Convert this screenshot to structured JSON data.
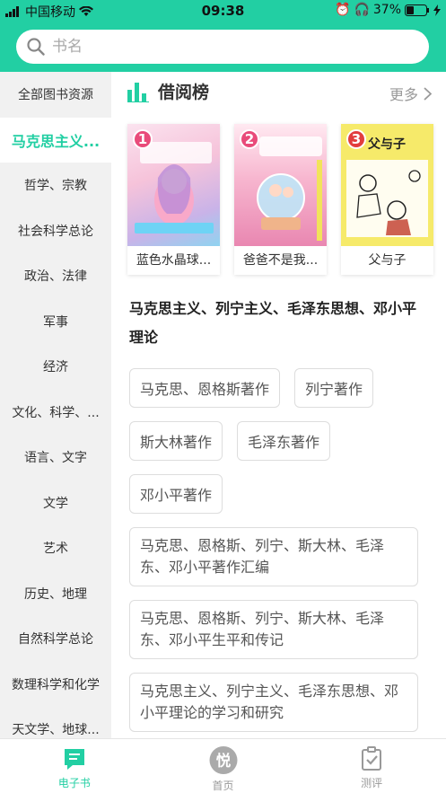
{
  "status_bar": {
    "carrier": "中国移动",
    "time": "09:38",
    "battery": "37%"
  },
  "search": {
    "placeholder": "书名"
  },
  "sidebar": {
    "items": [
      {
        "label": "全部图书资源"
      },
      {
        "label": "马克思主义..."
      },
      {
        "label": "哲学、宗教"
      },
      {
        "label": "社会科学总论"
      },
      {
        "label": "政治、法律"
      },
      {
        "label": "军事"
      },
      {
        "label": "经济"
      },
      {
        "label": "文化、科学、..."
      },
      {
        "label": "语言、文字"
      },
      {
        "label": "文学"
      },
      {
        "label": "艺术"
      },
      {
        "label": "历史、地理"
      },
      {
        "label": "自然科学总论"
      },
      {
        "label": "数理科学和化学"
      },
      {
        "label": "天文学、地球..."
      }
    ],
    "active_index": 1
  },
  "ranking": {
    "title": "借阅榜",
    "more_label": "更多",
    "books": [
      {
        "rank": "1",
        "title": "蓝色水晶球...",
        "badge_color": "#e94b7a"
      },
      {
        "rank": "2",
        "title": "爸爸不是我...",
        "badge_color": "#e94b7a"
      },
      {
        "rank": "3",
        "title": "父与子",
        "badge_color": "#e23d3d"
      }
    ]
  },
  "category": {
    "title": "马克思主义、列宁主义、毛泽东思想、邓小平理论",
    "tags": [
      {
        "label": "马克思、恩格斯著作"
      },
      {
        "label": "列宁著作"
      },
      {
        "label": "斯大林著作"
      },
      {
        "label": "毛泽东著作"
      },
      {
        "label": "邓小平著作"
      },
      {
        "label": "马克思、恩格斯、列宁、斯大林、毛泽东、邓小平著作汇编"
      },
      {
        "label": "马克思、恩格斯、列宁、斯大林、毛泽东、邓小平生平和传记"
      },
      {
        "label": "马克思主义、列宁主义、毛泽东思想、邓小平理论的学习和研究"
      }
    ]
  },
  "tabbar": {
    "tabs": [
      {
        "label": "电子书",
        "icon": "ebook-icon"
      },
      {
        "label": "首页",
        "icon": "yue-logo-icon"
      },
      {
        "label": "测评",
        "icon": "checklist-icon"
      }
    ]
  },
  "colors": {
    "accent": "#22cfa3"
  }
}
